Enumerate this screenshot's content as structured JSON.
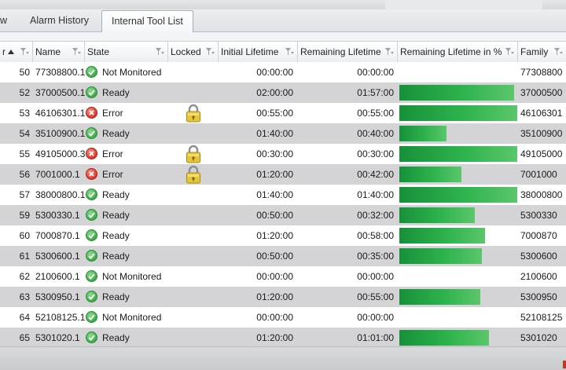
{
  "tabs": [
    {
      "label": "w",
      "active": false
    },
    {
      "label": "Alarm History",
      "active": false
    },
    {
      "label": "Internal Tool List",
      "active": true
    }
  ],
  "columns": {
    "number": "r",
    "name": "Name",
    "state": "State",
    "locked": "Locked",
    "initial_lifetime": "Initial Lifetime",
    "remaining_lifetime": "Remaining Lifetime",
    "remaining_pct": "Remaining Lifetime in %",
    "family": "Family"
  },
  "sort": {
    "column": "number",
    "direction": "ascending",
    "icon": "sort-up-icon"
  },
  "status_colors": {
    "ok": "#3ea84a",
    "error": "#d9352a",
    "bar": "#2eb34d"
  },
  "rows": [
    {
      "number": "50",
      "name": "77308800.1",
      "state": "Not Monitored",
      "state_icon": "ok",
      "locked": false,
      "initial": "00:00:00",
      "remaining": "00:00:00",
      "pct": null,
      "family": "77308800"
    },
    {
      "number": "52",
      "name": "37000500.1",
      "state": "Ready",
      "state_icon": "ok",
      "locked": false,
      "initial": "02:00:00",
      "remaining": "01:57:00",
      "pct": 97.5,
      "family": "37000500"
    },
    {
      "number": "53",
      "name": "46106301.1",
      "state": "Error",
      "state_icon": "error",
      "locked": true,
      "initial": "00:55:00",
      "remaining": "00:55:00",
      "pct": 100,
      "family": "46106301"
    },
    {
      "number": "54",
      "name": "35100900.1",
      "state": "Ready",
      "state_icon": "ok",
      "locked": false,
      "initial": "01:40:00",
      "remaining": "00:40:00",
      "pct": 40,
      "family": "35100900"
    },
    {
      "number": "55",
      "name": "49105000.3",
      "state": "Error",
      "state_icon": "error",
      "locked": true,
      "initial": "00:30:00",
      "remaining": "00:30:00",
      "pct": 100,
      "family": "49105000"
    },
    {
      "number": "56",
      "name": "7001000.1",
      "state": "Error",
      "state_icon": "error",
      "locked": true,
      "initial": "01:20:00",
      "remaining": "00:42:00",
      "pct": 52.5,
      "family": "7001000"
    },
    {
      "number": "57",
      "name": "38000800.1",
      "state": "Ready",
      "state_icon": "ok",
      "locked": false,
      "initial": "01:40:00",
      "remaining": "01:40:00",
      "pct": 100,
      "family": "38000800"
    },
    {
      "number": "59",
      "name": "5300330.1",
      "state": "Ready",
      "state_icon": "ok",
      "locked": false,
      "initial": "00:50:00",
      "remaining": "00:32:00",
      "pct": 64,
      "family": "5300330"
    },
    {
      "number": "60",
      "name": "7000870.1",
      "state": "Ready",
      "state_icon": "ok",
      "locked": false,
      "initial": "01:20:00",
      "remaining": "00:58:00",
      "pct": 72.5,
      "family": "7000870"
    },
    {
      "number": "61",
      "name": "5300600.1",
      "state": "Ready",
      "state_icon": "ok",
      "locked": false,
      "initial": "00:50:00",
      "remaining": "00:35:00",
      "pct": 70,
      "family": "5300600"
    },
    {
      "number": "62",
      "name": "2100600.1",
      "state": "Not Monitored",
      "state_icon": "ok",
      "locked": false,
      "initial": "00:00:00",
      "remaining": "00:00:00",
      "pct": null,
      "family": "2100600"
    },
    {
      "number": "63",
      "name": "5300950.1",
      "state": "Ready",
      "state_icon": "ok",
      "locked": false,
      "initial": "01:20:00",
      "remaining": "00:55:00",
      "pct": 68.75,
      "family": "5300950"
    },
    {
      "number": "64",
      "name": "52108125.1",
      "state": "Not Monitored",
      "state_icon": "ok",
      "locked": false,
      "initial": "00:00:00",
      "remaining": "00:00:00",
      "pct": null,
      "family": "52108125"
    },
    {
      "number": "65",
      "name": "5301020.1",
      "state": "Ready",
      "state_icon": "ok",
      "locked": false,
      "initial": "01:20:00",
      "remaining": "01:01:00",
      "pct": 76.25,
      "family": "5301020"
    }
  ]
}
